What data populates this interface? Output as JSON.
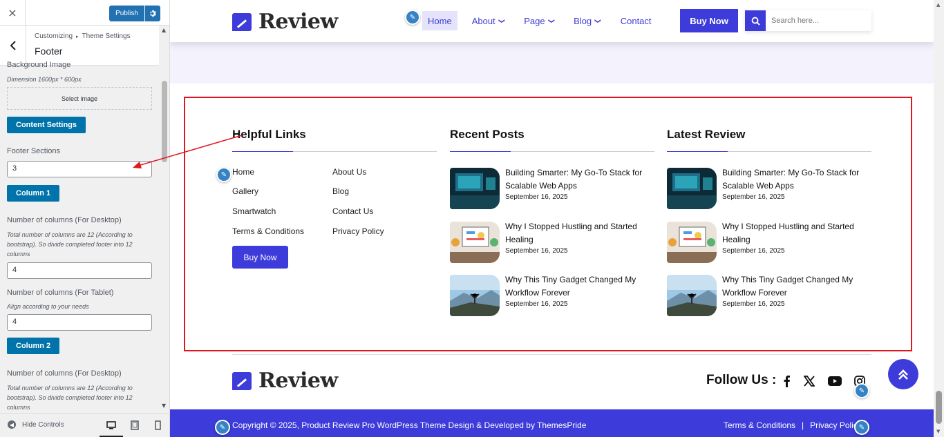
{
  "customizer": {
    "close_icon": "×",
    "publish_label": "Publish",
    "breadcrumb_root": "Customizing",
    "breadcrumb_sep": "▸",
    "breadcrumb_section": "Theme Settings",
    "section_title": "Footer",
    "background_image_label": "Background Image",
    "dimension_desc": "Dimension 1600px * 600px",
    "select_image_label": "Select image",
    "content_settings_label": "Content Settings",
    "footer_sections_label": "Footer Sections",
    "footer_sections_value": "3",
    "column1_label": "Column 1",
    "col1_desktop_label": "Number of columns (For Desktop)",
    "col1_desktop_desc": "Total number of columns are 12 (According to bootstrap). So divide completed footer into 12 columns",
    "col1_desktop_value": "4",
    "col1_tablet_label": "Number of columns (For Tablet)",
    "col1_tablet_desc": "Align according to your needs",
    "col1_tablet_value": "4",
    "column2_label": "Column 2",
    "col2_desktop_label": "Number of columns (For Desktop)",
    "col2_desktop_desc": "Total number of columns are 12 (According to bootstrap). So divide completed footer into 12 columns",
    "hide_controls_label": "Hide Controls"
  },
  "site": {
    "logo_text": "Review",
    "nav": [
      {
        "label": "Home",
        "active": true
      },
      {
        "label": "About",
        "dropdown": true
      },
      {
        "label": "Page",
        "dropdown": true
      },
      {
        "label": "Blog",
        "dropdown": true
      },
      {
        "label": "Contact"
      }
    ],
    "buy_now_label": "Buy Now",
    "search_placeholder": "Search here...",
    "accent_color": "#3d3bd9"
  },
  "footer": {
    "helpful_links_title": "Helpful Links",
    "links_left": [
      "Home",
      "Gallery",
      "Smartwatch",
      "Terms & Conditions"
    ],
    "links_right": [
      "About Us",
      "Blog",
      "Contact Us",
      "Privacy Policy"
    ],
    "buy_now_label": "Buy Now",
    "recent_posts_title": "Recent Posts",
    "latest_review_title": "Latest Review",
    "posts": [
      {
        "title": "Building Smarter: My Go-To Stack for Scalable Web Apps",
        "date": "September 16, 2025",
        "thumb": "tech"
      },
      {
        "title": "Why I Stopped Hustling and Started Healing",
        "date": "September 16, 2025",
        "thumb": "ideas"
      },
      {
        "title": "Why This Tiny Gadget Changed My Workflow Forever",
        "date": "September 16, 2025",
        "thumb": "mountain"
      }
    ],
    "follow_us_label": "Follow Us :",
    "social_icons": [
      "facebook-icon",
      "x-icon",
      "youtube-icon",
      "instagram-icon"
    ],
    "copyright": "Copyright © 2025, Product Review Pro WordPress Theme Design & Developed by ThemesPride",
    "bottom_links": [
      "Terms & Conditions",
      "Privacy Policy"
    ],
    "bottom_link_sep": "|"
  }
}
